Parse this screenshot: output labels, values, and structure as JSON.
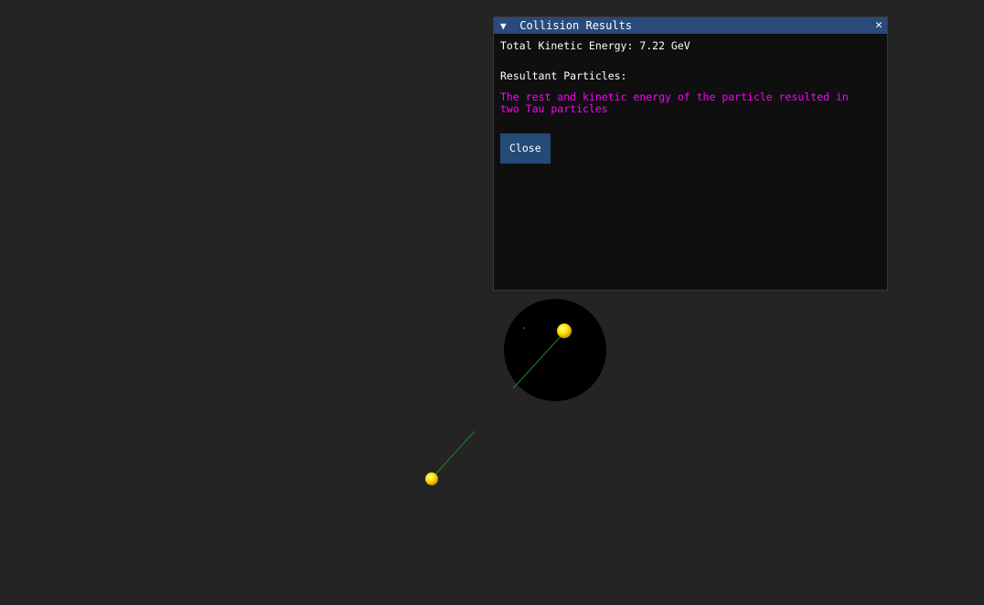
{
  "window": {
    "title": "Collision Results",
    "collapse_glyph": "▼",
    "close_glyph": "✕",
    "kinetic_energy_text": "Total Kinetic Energy: 7.22 GeV",
    "resultant_label": "Resultant Particles:",
    "result_message": "The rest and kinetic energy of the particle resulted in two Tau particles",
    "close_button_label": "Close"
  },
  "colors": {
    "background": "#242424",
    "panel": "#0f0f0f",
    "titlebar": "#294a7a",
    "button": "#264a78",
    "highlight_text": "#ff00ff",
    "particle": "#ffdd00",
    "trail": "#1f8a1f"
  }
}
